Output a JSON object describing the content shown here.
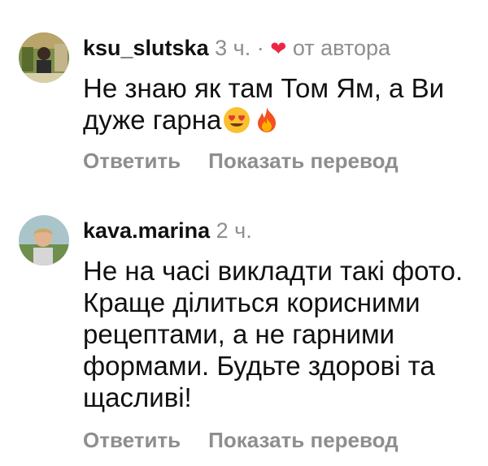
{
  "comments": [
    {
      "username": "ksu_slutska",
      "time": "3 ч.",
      "separator": "·",
      "liked_by_author": "от автора",
      "text": "Не знаю як там Том Ям, а Ви дуже гарна",
      "emojis": [
        "heart-eyes-emoji",
        "fire-emoji"
      ],
      "reply_label": "Ответить",
      "translate_label": "Показать перевод"
    },
    {
      "username": "kava.marina",
      "time": "2 ч.",
      "text": "Не на часі викладти такі фото. Краще ділиться корисними рецептами, а не гарними формами. Будьте здорові та щасливі!",
      "reply_label": "Ответить",
      "translate_label": "Показать перевод"
    }
  ],
  "colors": {
    "meta_gray": "#8e8e8e",
    "heart_red": "#ed2645",
    "text": "#111111"
  }
}
